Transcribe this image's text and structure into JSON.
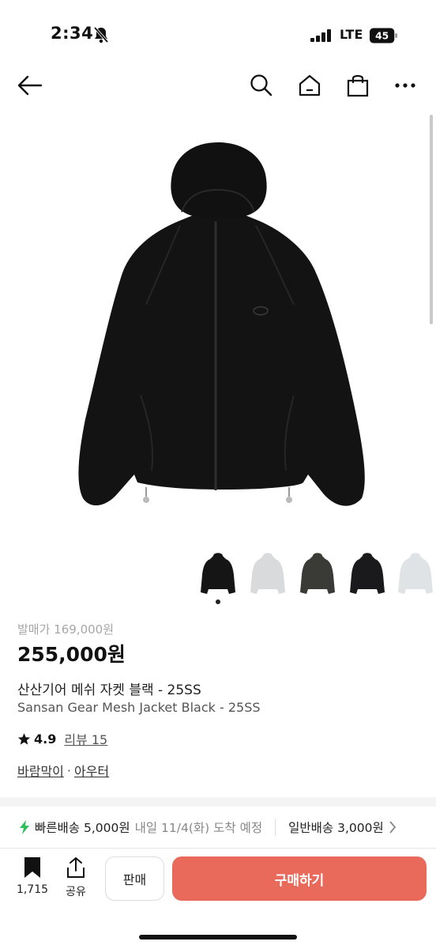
{
  "status_bar": {
    "time": "2:34",
    "network": "LTE",
    "battery": "45"
  },
  "product": {
    "original_price": "발매가 169,000원",
    "price": "255,000원",
    "name_ko": "산산기어 메쉬 자켓 블랙 - 25SS",
    "name_en": "Sansan Gear Mesh Jacket Black - 25SS",
    "rating": "4.9",
    "reviews": "리뷰 15",
    "category_1": "바람막이",
    "separator": "·",
    "category_2": "아우터"
  },
  "thumbnails": [
    {
      "color": "#151515",
      "selected": true
    },
    {
      "color": "#d8dadc",
      "selected": false
    },
    {
      "color": "#3a3b36",
      "selected": false
    },
    {
      "color": "#1a1a1c",
      "selected": false
    },
    {
      "color": "#dfe3e6",
      "selected": false
    }
  ],
  "shipping": {
    "fast_label": "빠른배송 5,000원",
    "fast_eta": "내일 11/4(화) 도착 예정",
    "normal_label": "일반배송 3,000원"
  },
  "bottom_bar": {
    "bookmark_count": "1,715",
    "share_label": "공유",
    "sell_label": "판매",
    "buy_label": "구매하기"
  },
  "colors": {
    "accent": "#e96a5b",
    "fast_bolt": "#2fbe5b"
  },
  "icons": [
    "back-arrow-icon",
    "search-icon",
    "home-icon",
    "shopping-bag-icon",
    "more-icon",
    "bookmark-icon",
    "share-icon",
    "bolt-icon",
    "chevron-right-icon",
    "star-icon",
    "bell-slash-icon"
  ]
}
